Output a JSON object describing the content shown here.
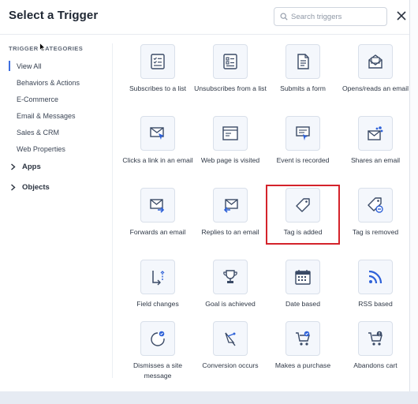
{
  "modal": {
    "title": "Select a Trigger",
    "search_placeholder": "Search triggers",
    "close_icon": "close-icon"
  },
  "sidebar": {
    "heading": "TRIGGER CATEGORIES",
    "categories": [
      {
        "label": "View All",
        "active": true
      },
      {
        "label": "Behaviors & Actions"
      },
      {
        "label": "E-Commerce"
      },
      {
        "label": "Email & Messages"
      },
      {
        "label": "Sales & CRM"
      },
      {
        "label": "Web Properties"
      }
    ],
    "groups": [
      {
        "label": "Apps"
      },
      {
        "label": "Objects"
      }
    ]
  },
  "triggers": [
    {
      "label": "Subscribes to a list",
      "icon": "list-check-icon"
    },
    {
      "label": "Unsubscribes from a list",
      "icon": "list-remove-icon"
    },
    {
      "label": "Submits a form",
      "icon": "form-icon"
    },
    {
      "label": "Opens/reads an email",
      "icon": "open-email-icon"
    },
    {
      "label": "Clicks a link in an email",
      "icon": "email-click-icon"
    },
    {
      "label": "Web page is visited",
      "icon": "webpage-icon"
    },
    {
      "label": "Event is recorded",
      "icon": "event-icon"
    },
    {
      "label": "Shares an email",
      "icon": "share-email-icon"
    },
    {
      "label": "Forwards an email",
      "icon": "forward-email-icon"
    },
    {
      "label": "Replies to an email",
      "icon": "reply-email-icon"
    },
    {
      "label": "Tag is added",
      "icon": "tag-icon",
      "highlighted": true
    },
    {
      "label": "Tag is removed",
      "icon": "tag-remove-icon"
    },
    {
      "label": "Field changes",
      "icon": "field-change-icon"
    },
    {
      "label": "Goal is achieved",
      "icon": "trophy-icon"
    },
    {
      "label": "Date based",
      "icon": "calendar-icon"
    },
    {
      "label": "RSS based",
      "icon": "rss-icon"
    },
    {
      "label": "Dismisses a site message",
      "icon": "dismiss-message-icon"
    },
    {
      "label": "Conversion occurs",
      "icon": "conversion-icon"
    },
    {
      "label": "Makes a purchase",
      "icon": "cart-icon"
    },
    {
      "label": "Abandons cart",
      "icon": "cart-abandon-icon"
    }
  ],
  "colors": {
    "accent": "#3e6fe0",
    "icon_dark": "#3a4a66",
    "icon_blue": "#2f62d8",
    "highlight": "#d4232b"
  }
}
